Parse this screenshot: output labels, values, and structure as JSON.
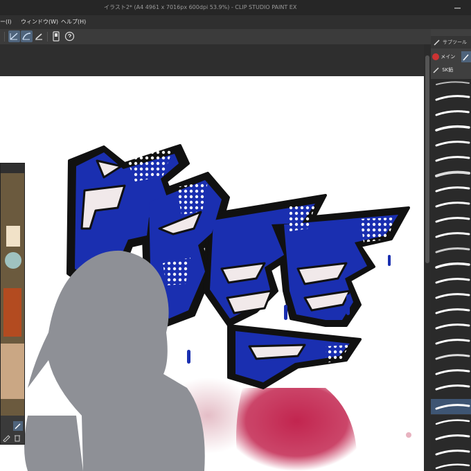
{
  "window": {
    "title": "イラスト2* (A4 4961 x 7016px 600dpi 53.9%) - CLIP STUDIO PAINT EX"
  },
  "menu": {
    "items": [
      "ー(I)",
      "ウィンドウ(W)",
      "ヘルプ(H)"
    ]
  },
  "right_panel": {
    "header": "サブツール",
    "tabs": [
      "メイン",
      "SK鉛"
    ]
  },
  "artwork": {
    "lettering": "FREE"
  },
  "icons": [
    "window-minimize-icon",
    "ruler-icon",
    "pen-icon",
    "eyedropper-icon",
    "trash-icon"
  ],
  "colors": {
    "accent": "#4f647c",
    "graffiti_blue": "#1a2fb0",
    "spray_red": "#c2254f",
    "silhouette_gray": "#8e9096"
  }
}
